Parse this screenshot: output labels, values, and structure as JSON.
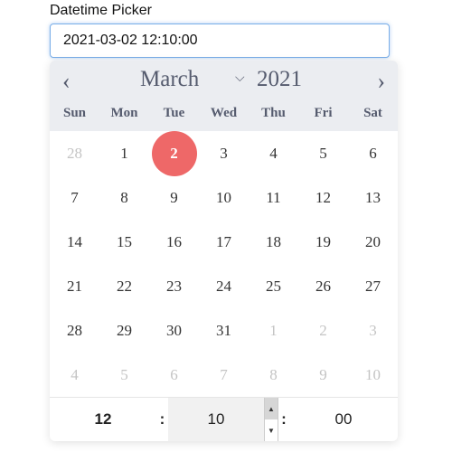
{
  "label": "Datetime Picker",
  "input_value": "2021-03-02 12:10:00",
  "header": {
    "prev": "‹",
    "next": "›",
    "month": "March",
    "year": "2021",
    "chevron": "⌄"
  },
  "weekdays": [
    "Sun",
    "Mon",
    "Tue",
    "Wed",
    "Thu",
    "Fri",
    "Sat"
  ],
  "days": [
    {
      "d": "28",
      "other": true
    },
    {
      "d": "1"
    },
    {
      "d": "2",
      "selected": true
    },
    {
      "d": "3"
    },
    {
      "d": "4"
    },
    {
      "d": "5"
    },
    {
      "d": "6"
    },
    {
      "d": "7"
    },
    {
      "d": "8"
    },
    {
      "d": "9"
    },
    {
      "d": "10"
    },
    {
      "d": "11"
    },
    {
      "d": "12"
    },
    {
      "d": "13"
    },
    {
      "d": "14"
    },
    {
      "d": "15"
    },
    {
      "d": "16"
    },
    {
      "d": "17"
    },
    {
      "d": "18"
    },
    {
      "d": "19"
    },
    {
      "d": "20"
    },
    {
      "d": "21"
    },
    {
      "d": "22"
    },
    {
      "d": "23"
    },
    {
      "d": "24"
    },
    {
      "d": "25"
    },
    {
      "d": "26"
    },
    {
      "d": "27"
    },
    {
      "d": "28"
    },
    {
      "d": "29"
    },
    {
      "d": "30"
    },
    {
      "d": "31"
    },
    {
      "d": "1",
      "other": true
    },
    {
      "d": "2",
      "other": true
    },
    {
      "d": "3",
      "other": true
    },
    {
      "d": "4",
      "other": true
    },
    {
      "d": "5",
      "other": true
    },
    {
      "d": "6",
      "other": true
    },
    {
      "d": "7",
      "other": true
    },
    {
      "d": "8",
      "other": true
    },
    {
      "d": "9",
      "other": true
    },
    {
      "d": "10",
      "other": true
    }
  ],
  "time": {
    "hour": "12",
    "minute": "10",
    "second": "00",
    "sep": ":",
    "up": "▲",
    "down": "▼"
  },
  "colors": {
    "selected": "#ee6868",
    "header_bg": "#ebedf1",
    "focus_border": "#7aaee8"
  }
}
